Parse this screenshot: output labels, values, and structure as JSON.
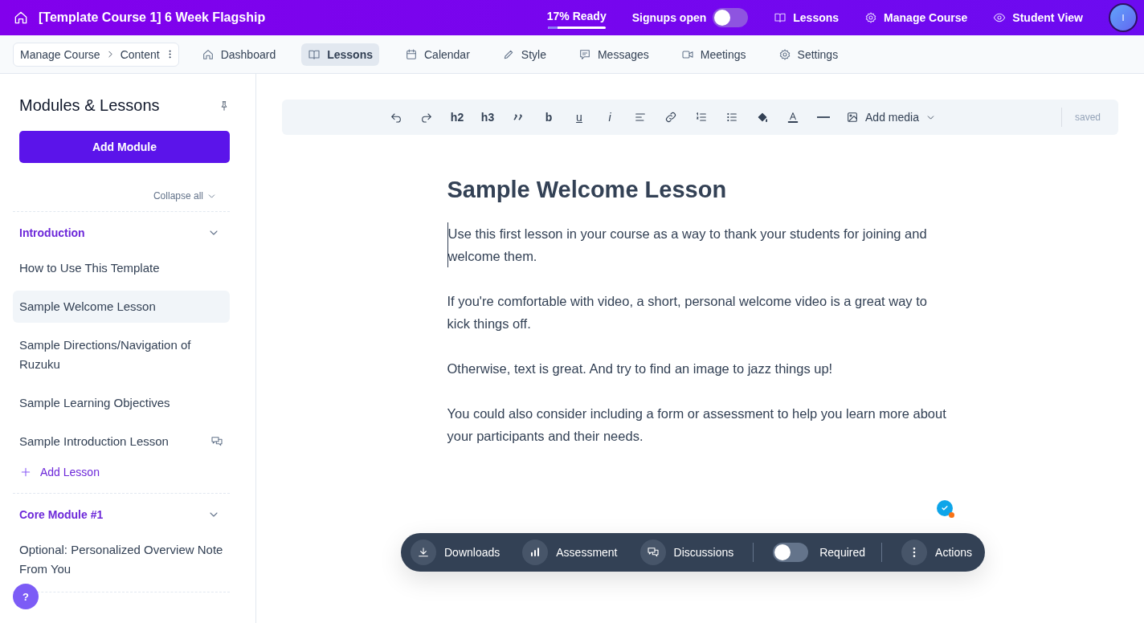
{
  "topbar": {
    "title": "[Template Course 1] 6 Week Flagship",
    "readiness": {
      "text": "17% Ready",
      "level": 0.17
    },
    "signups": {
      "label": "Signups open",
      "on": false
    },
    "links": [
      {
        "label": "Lessons"
      },
      {
        "label": "Manage Course"
      },
      {
        "label": "Student View"
      }
    ],
    "avatar": "I"
  },
  "subnav": {
    "breadcrumb": [
      "Manage Course",
      "Content"
    ],
    "tabs": [
      {
        "label": "Dashboard",
        "selected": false
      },
      {
        "label": "Lessons",
        "selected": true
      },
      {
        "label": "Calendar",
        "selected": false
      },
      {
        "label": "Style",
        "selected": false
      },
      {
        "label": "Messages",
        "selected": false
      },
      {
        "label": "Meetings",
        "selected": false
      },
      {
        "label": "Settings",
        "selected": false
      }
    ]
  },
  "sidebar": {
    "title": "Modules & Lessons",
    "add_module": "Add Module",
    "collapse_all": "Collapse all",
    "modules": [
      {
        "title": "Introduction",
        "expanded": true,
        "lessons": [
          {
            "title": "How to Use This Template",
            "selected": false,
            "discussion": false
          },
          {
            "title": "Sample Welcome Lesson",
            "selected": true,
            "discussion": false
          },
          {
            "title": "Sample Directions/Navigation of Ruzuku",
            "selected": false,
            "discussion": false
          },
          {
            "title": "Sample Learning Objectives",
            "selected": false,
            "discussion": false
          },
          {
            "title": "Sample Introduction Lesson",
            "selected": false,
            "discussion": true
          }
        ],
        "add_lesson": "Add Lesson"
      },
      {
        "title": "Core Module #1",
        "expanded": true,
        "lessons": [
          {
            "title": "Optional: Personalized Overview Note From You",
            "selected": false,
            "discussion": false
          }
        ]
      }
    ],
    "help": "?"
  },
  "editor_toolbar": {
    "items": [
      {
        "kind": "icon"
      },
      {
        "kind": "icon"
      },
      {
        "kind": "text",
        "label": "h2"
      },
      {
        "kind": "text",
        "label": "h3"
      },
      {
        "kind": "icon"
      },
      {
        "kind": "text",
        "label": "b"
      },
      {
        "kind": "text",
        "label": "u"
      },
      {
        "kind": "text",
        "label": "i"
      },
      {
        "kind": "icon"
      },
      {
        "kind": "icon"
      },
      {
        "kind": "icon"
      },
      {
        "kind": "icon"
      },
      {
        "kind": "icon"
      },
      {
        "kind": "icon"
      },
      {
        "kind": "icon"
      },
      {
        "kind": "menu",
        "label": "Add media"
      }
    ],
    "status": "saved"
  },
  "lesson": {
    "title": "Sample Welcome Lesson",
    "paragraphs": [
      "Use this first lesson in your course as a way to thank your students for joining and welcome them.",
      "If you're comfortable with video, a short, personal welcome video is a great way to kick things off.",
      "Otherwise, text is great. And try to find an image to jazz things up!",
      "You could also consider including a form or assessment to help you learn more about your participants and their needs."
    ]
  },
  "action_bar": {
    "items": [
      {
        "label": "Downloads"
      },
      {
        "label": "Assessment"
      },
      {
        "label": "Discussions"
      }
    ],
    "required": {
      "label": "Required",
      "on": false
    },
    "actions": "Actions"
  }
}
